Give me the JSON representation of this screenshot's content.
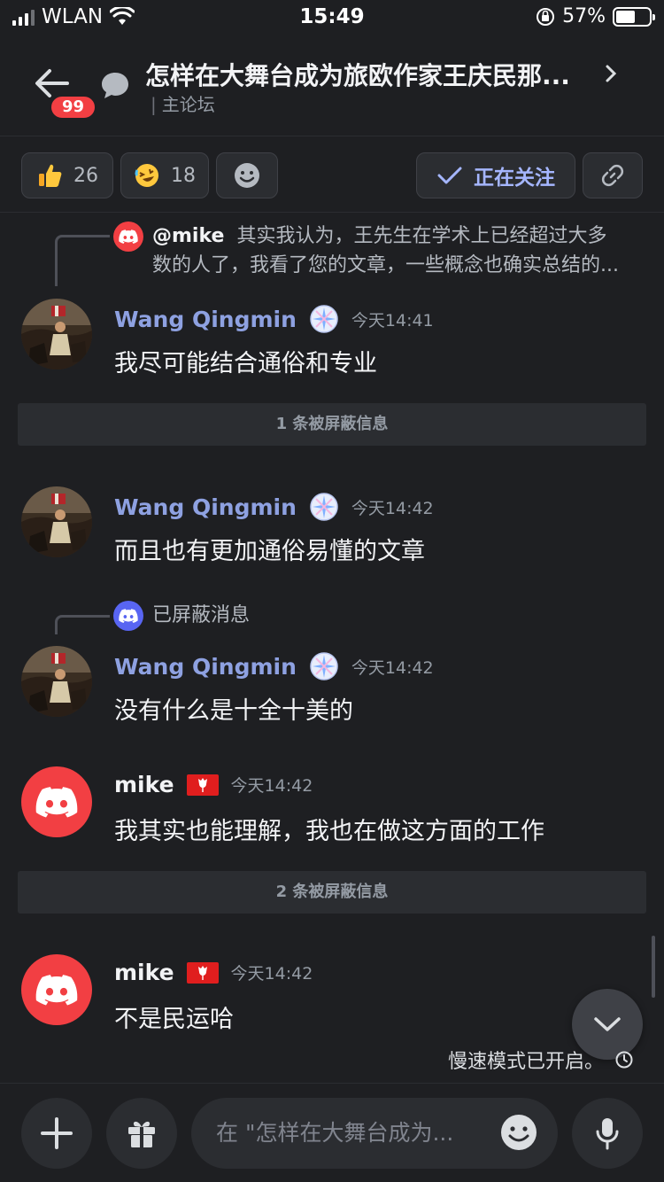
{
  "status_bar": {
    "carrier": "WLAN",
    "time": "15:49",
    "battery_percent": "57%",
    "battery_level": 0.57
  },
  "header": {
    "title": "怎样在大舞台成为旅欧作家王庆民那...",
    "subtitle": "主论坛",
    "unread_badge": "99"
  },
  "reactions": [
    {
      "emoji": "thumbs-up",
      "count": "26"
    },
    {
      "emoji": "rofl",
      "count": "18"
    }
  ],
  "follow_label": "正在关注",
  "messages": [
    {
      "reply_to": {
        "user": "@mike",
        "text_line1": "其实我认为，王先生在学术上已经超过大多",
        "text_line2": "数的人了，我看了您的文章，一些概念也确实总结的..."
      },
      "author": "Wang Qingmin",
      "time": "今天14:41",
      "text": "我尽可能结合通俗和专业"
    },
    {
      "blocked": "1 条被屏蔽信息"
    },
    {
      "author": "Wang Qingmin",
      "time": "今天14:42",
      "text": "而且也有更加通俗易懂的文章"
    },
    {
      "reply_to": {
        "text": "已屏蔽消息"
      },
      "author": "Wang Qingmin",
      "time": "今天14:42",
      "text": "没有什么是十全十美的"
    },
    {
      "author": "mike",
      "time": "今天14:42",
      "text": "我其实也能理解，我也在做这方面的工作"
    },
    {
      "blocked": "2 条被屏蔽信息"
    },
    {
      "author": "mike",
      "time": "今天14:42",
      "text": "不是民运哈"
    }
  ],
  "slow_mode": "慢速模式已开启。",
  "composer": {
    "placeholder": "在 \"怎样在大舞台成为..."
  },
  "colors": {
    "background": "#1e1f22",
    "accent": "#5865f2",
    "danger": "#f23f43",
    "link_name": "#8ea1e1"
  }
}
